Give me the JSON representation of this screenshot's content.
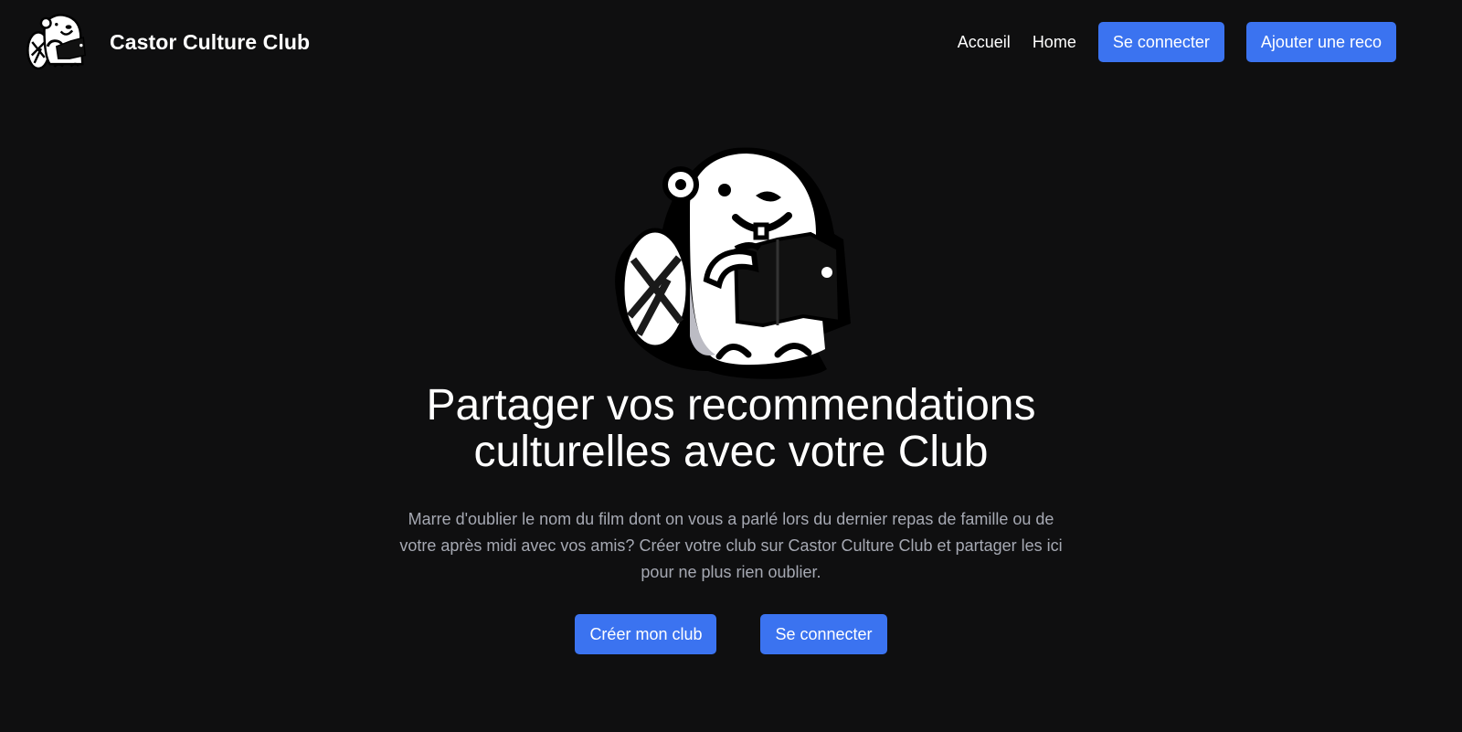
{
  "brand": {
    "name": "Castor Culture Club",
    "logo_icon": "beaver-reading-logo"
  },
  "nav": {
    "links": [
      "Accueil",
      "Home"
    ],
    "login_label": "Se connecter",
    "add_reco_label": "Ajouter une reco"
  },
  "hero": {
    "illustration_icon": "beaver-reading-book-illustration",
    "title": "Partager vos recommendations culturelles avec votre Club",
    "description": "Marre d'oublier le nom du film dont on vous a parlé lors du dernier repas de famille ou de votre après midi avec vos amis? Créer votre club sur Castor Culture Club et partager les ici pour ne plus rien oublier.",
    "create_club_label": "Créer mon club",
    "login_label": "Se connecter"
  },
  "colors": {
    "background": "#0f0f10",
    "accent": "#3b73f0",
    "muted_text": "#a6a9b3"
  }
}
